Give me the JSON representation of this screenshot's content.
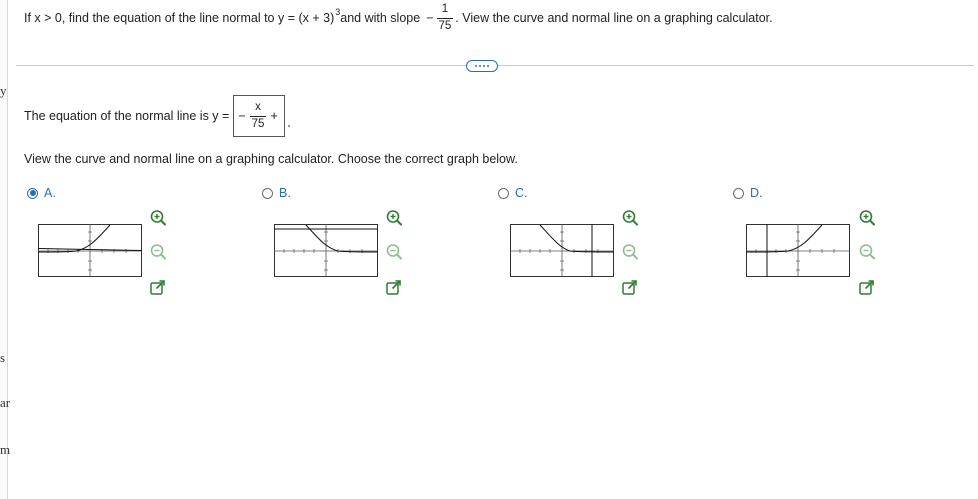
{
  "left_margin_glyphs": [
    "y",
    "s",
    "ar",
    "m"
  ],
  "question": {
    "prefix": "If x > 0, find the equation of the line normal to y = (x + 3)",
    "exponent": "3",
    "middle": " and with slope",
    "slope_sign": "−",
    "slope_num": "1",
    "slope_den": "75",
    "suffix": ". View the curve and normal line on a graphing calculator."
  },
  "answer": {
    "label": "The equation of the normal line is y =",
    "sign": "−",
    "numerator": "x",
    "denominator": "75",
    "plus": "+",
    "constant_value": ""
  },
  "instruction": "View the curve and normal line on a graphing calculator. Choose the correct graph below.",
  "choices": [
    {
      "letter": "A.",
      "selected": true
    },
    {
      "letter": "B.",
      "selected": false
    },
    {
      "letter": "C.",
      "selected": false
    },
    {
      "letter": "D.",
      "selected": false
    }
  ],
  "icons": {
    "zoom_in": "zoom-in-icon",
    "zoom_out": "zoom-out-icon",
    "open_new": "open-new-window-icon"
  },
  "colors": {
    "accent": "#2b6cb8",
    "text": "#222222",
    "divider": "#c9c9c9"
  }
}
